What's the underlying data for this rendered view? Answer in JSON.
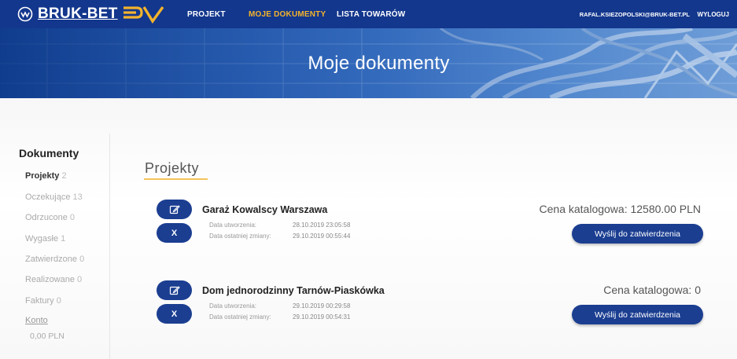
{
  "header": {
    "logo_text": "BRUK-BET",
    "logo_suffix": "PV",
    "nav": [
      {
        "label": "PROJEKT",
        "active": false
      },
      {
        "label": "MOJE DOKUMENTY",
        "active": true
      },
      {
        "label": "LISTA TOWARÓW",
        "active": false
      }
    ],
    "user_email": "RAFAL.KSIEZOPOLSKI@BRUK-BET.PL",
    "logout_label": "WYLOGUJ"
  },
  "hero": {
    "title": "Moje dokumenty"
  },
  "sidebar": {
    "title": "Dokumenty",
    "items": [
      {
        "label": "Projekty",
        "count": "2",
        "active": true
      },
      {
        "label": "Oczekujące",
        "count": "13",
        "active": false
      },
      {
        "label": "Odrzucone",
        "count": "0",
        "active": false
      },
      {
        "label": "Wygasłe",
        "count": "1",
        "active": false
      },
      {
        "label": "Zatwierdzone",
        "count": "0",
        "active": false
      },
      {
        "label": "Realizowane",
        "count": "0",
        "active": false
      },
      {
        "label": "Faktury",
        "count": "0",
        "active": false
      }
    ],
    "account_label": "Konto",
    "balance": "0,00 PLN"
  },
  "section": {
    "title": "Projekty"
  },
  "projects": [
    {
      "name": "Garaż Kowalscy Warszawa",
      "created_label": "Data utworzenia:",
      "created_value": "28.10.2019 23:05:58",
      "modified_label": "Data ostatniej zmiany:",
      "modified_value": "29.10.2019 00:55:44",
      "price": "Cena katalogowa: 12580.00 PLN",
      "send_label": "Wyślij do zatwierdzenia",
      "delete_label": "X"
    },
    {
      "name": "Dom jednorodzinny Tarnów-Piaskówka",
      "created_label": "Data utworzenia:",
      "created_value": "29.10.2019 00:29:58",
      "modified_label": "Data ostatniej zmiany:",
      "modified_value": "29.10.2019 00:54:31",
      "price": "Cena katalogowa: 0",
      "send_label": "Wyślij do zatwierdzenia",
      "delete_label": "X"
    }
  ],
  "colors": {
    "primary": "#13378d",
    "button": "#1b3e91",
    "accent": "#f3b32c"
  },
  "icons": {
    "logo": "bruk-bet-logo-icon",
    "edit": "edit-icon"
  }
}
